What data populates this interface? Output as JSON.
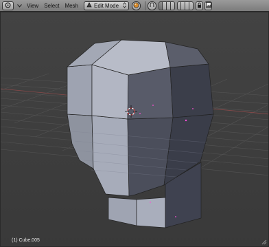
{
  "header": {
    "menus": [
      "View",
      "Select",
      "Mesh"
    ],
    "mode": "Edit Mode",
    "editor_type_icon": "3d-view-icon",
    "mode_icon": "edit-mode-triangle-icon"
  },
  "viewport": {
    "status": "(1) Cube.005",
    "background_color": "#3e3e3e",
    "grid_color": "#4f4f4f",
    "mesh_light": "#a4a9b8",
    "mesh_dark": "#3d404c",
    "selected_vertex_color": "#ff4fd8"
  }
}
